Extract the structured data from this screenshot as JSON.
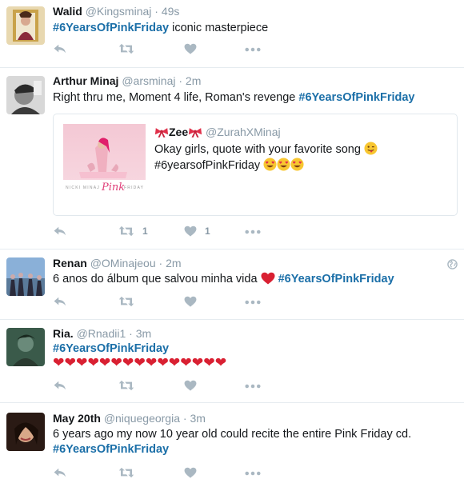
{
  "colors": {
    "hashtag": "#1b6fa8",
    "muted": "#8899a6",
    "heart": "#d92032",
    "border": "#e6ecf0"
  },
  "tweets": [
    {
      "name": "Walid",
      "handle": "@Kingsminaj",
      "time": "49s",
      "tag": "#6YearsOfPinkFriday",
      "text_after": "iconic masterpiece"
    },
    {
      "name": "Arthur Minaj",
      "handle": "@arsminaj",
      "time": "2m",
      "text_before": "Right thru me, Moment 4 life, Roman's revenge",
      "tag": "#6YearsOfPinkFriday",
      "retweets": "1",
      "likes": "1",
      "quote": {
        "name": "Zee",
        "handle": "@ZurahXMinaj",
        "line1": "Okay girls, quote with your favorite song",
        "tag": "#6yearsofPinkFriday",
        "album_artist": "NICKI MINAJ",
        "album_title": "Pink",
        "album_sub": "FRIDAY",
        "emojis": "😍😍😍"
      }
    },
    {
      "name": "Renan",
      "handle": "@OMinajeou",
      "time": "2m",
      "text_before": "6 anos do álbum que salvou minha vida",
      "tag": "#6YearsOfPinkFriday"
    },
    {
      "name": "Ria.",
      "handle": "@Rnadii1",
      "time": "3m",
      "tag": "#6YearsOfPinkFriday",
      "hearts": "❤❤❤❤❤❤❤❤❤❤❤❤❤❤❤"
    },
    {
      "name": "May 20th",
      "handle": "@niquegeorgia",
      "time": "3m",
      "text_before": "6 years ago my now 10 year old could recite the entire Pink Friday cd.",
      "tag": "#6YearsOfPinkFriday"
    }
  ],
  "dot": "·",
  "icons": [
    "reply-icon",
    "retweet-icon",
    "like-icon",
    "more-icon",
    "globe-icon",
    "heart-emoji",
    "bow-emoji"
  ]
}
